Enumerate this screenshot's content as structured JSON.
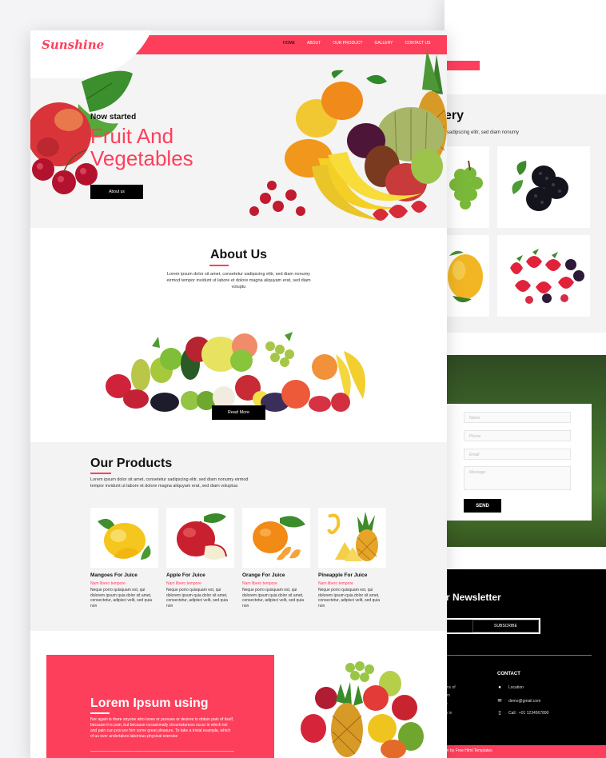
{
  "site": {
    "logo": "Sunshine"
  },
  "nav": {
    "items": [
      "HOME",
      "ABOUT",
      "OUR PRODUCT",
      "GALLERY",
      "CONTACT US"
    ],
    "active": "HOME"
  },
  "hero": {
    "kicker": "Now started",
    "title_line1": "Fruit And",
    "title_line2": "Vegetables",
    "button": "About us"
  },
  "about": {
    "title": "About Us",
    "text": "Lorem ipsum dolor sit amet, consetetur sadipscing elitr, sed diam nonumy eirmod tempor invidunt ut labore et dolore magna aliquyam erat, sed diam voluptu",
    "button": "Read More"
  },
  "products": {
    "title": "Our Products",
    "intro": "Lorem ipsum dolor sit amet, consetetur sadipscing elitr, sed diam nonumy eirmod tempor invidunt ut labore et dolore magna aliquyam erat, sed diam voluptua",
    "items": [
      {
        "name": "Mangoes For Juice",
        "sub": "Nam libero tempore",
        "desc": "Neque porro quisquam est, qui dolorem ipsum quia dolor sit amet, consectetur, adipisci velit, sed quia non"
      },
      {
        "name": "Apple For Juice",
        "sub": "Nam libero tempore",
        "desc": "Neque porro quisquam est, qui dolorem ipsum quia dolor sit amet, consectetur, adipisci velit, sed quia non"
      },
      {
        "name": "Orange For Juice",
        "sub": "Nam libero tempore",
        "desc": "Neque porro quisquam est, qui dolorem ipsum quia dolor sit amet, consectetur, adipisci velit, sed quia non"
      },
      {
        "name": "Pineapple For Juice",
        "sub": "Nam libero tempore",
        "desc": "Neque porro quisquam est, qui dolorem ipsum quia dolor sit amet, consectetur, adipisci velit, sed quia non"
      }
    ]
  },
  "lorem": {
    "title": "Lorem Ipsum using",
    "text": "Nor again is there anyone who loves or pursues or desires to obtain pain of itself, because it is pain, but because occasionally circumstances occur in which toil and pain can procure him some great pleasure. To take a trivial example, which of us ever undertakes laborious physical exercise"
  },
  "gallery": {
    "title_fragment": "ery",
    "text_fragment": "sadipscing elitr, sed diam nonumy"
  },
  "contact_form": {
    "name_placeholder": "Name",
    "phone_placeholder": "Phone",
    "email_placeholder": "Email",
    "message_placeholder": "Message",
    "send": "SEND"
  },
  "footer": {
    "newsletter_fragment": "r Newsletter",
    "subscribe": "SUBSCRIBE",
    "contact_title": "CONTACT",
    "location": "Location",
    "email": "demo@gmail.com",
    "call": "Call : +01 1234567890",
    "left_fragments": [
      "ons of",
      "um",
      "ty",
      "m in"
    ],
    "copyright_fragment": "gn by Free Html Templates"
  },
  "colors": {
    "accent": "#fe3f5c",
    "dark": "#000000"
  }
}
